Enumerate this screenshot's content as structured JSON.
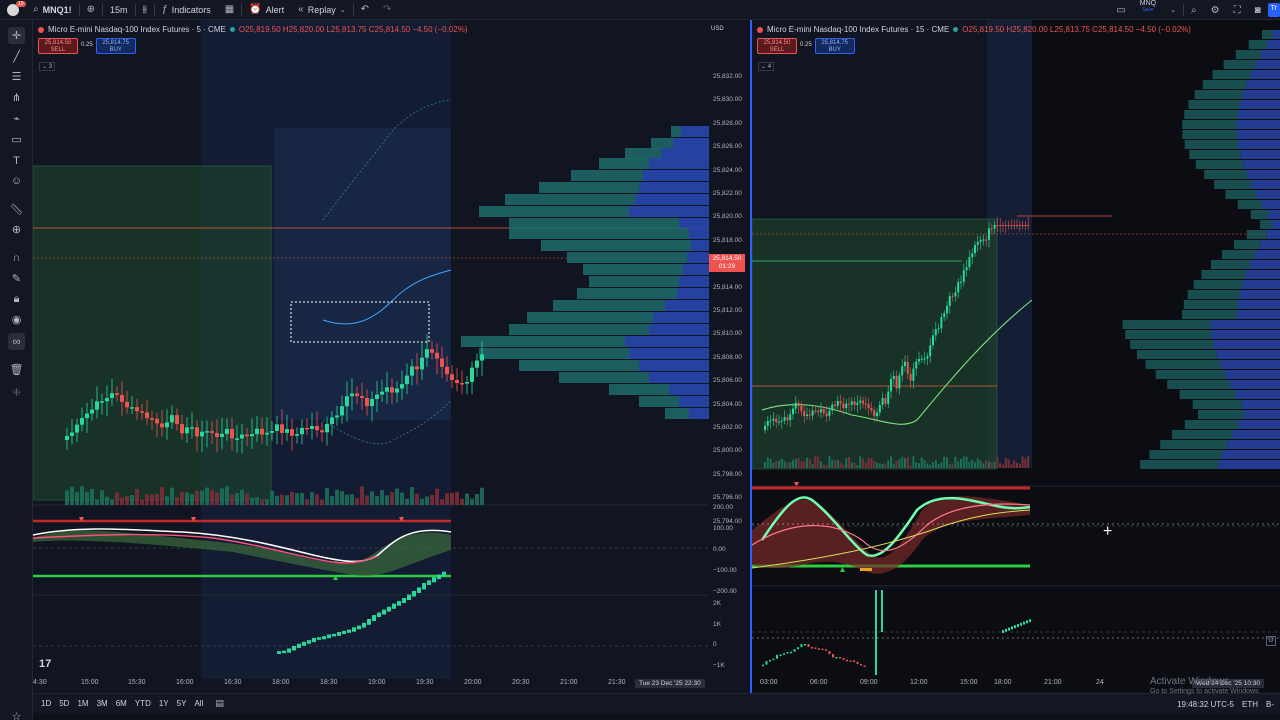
{
  "toolbar": {
    "notification_count": "10",
    "symbol": "MNQ1!",
    "interval": "15m",
    "indicators_label": "Indicators",
    "alert_label": "Alert",
    "replay_label": "Replay",
    "right_symbol": "MNQ",
    "right_symbol_sub": "Save",
    "right_cut": "Tr"
  },
  "left_chart": {
    "title": "Micro E-mini Nasdaq-100 Index Futures · 5 · CME",
    "ohlc": "O25,819.50 H25,820.00 L25,813.75 C25,814.50 −4.50 (−0.02%)",
    "sell_price": "25,814.50",
    "sell_label": "SELL",
    "qty": "0.25",
    "buy_price": "25,814.75",
    "buy_label": "BUY",
    "collapse_label": "3",
    "currency": "USD",
    "price_ticks": [
      "25,832.00",
      "25,830.00",
      "25,828.00",
      "25,826.00",
      "25,824.00",
      "25,822.00",
      "25,820.00",
      "25,818.00",
      "25,816.00",
      "25,814.00",
      "25,812.00",
      "25,810.00",
      "25,808.00",
      "25,806.00",
      "25,804.00",
      "25,802.00",
      "25,800.00",
      "25,798.00",
      "25,796.00",
      "25,794.00"
    ],
    "current_price": "25,814.50",
    "countdown": "01:29",
    "osc_ticks": [
      "200.00",
      "100.00",
      "0.00",
      "−100.00",
      "−200.00"
    ],
    "vol_ticks": [
      "2K",
      "1K",
      "0",
      "−1K"
    ],
    "time_ticks": [
      "4:30",
      "15:00",
      "15:30",
      "16:00",
      "16:30",
      "18:00",
      "18:30",
      "19:00",
      "19:30",
      "20:00",
      "20:30",
      "21:00",
      "21:30"
    ],
    "date_badge": "Tue 23 Dec '25   22:30"
  },
  "right_chart": {
    "title": "Micro E-mini Nasdaq-100 Index Futures · 15 · CME",
    "ohlc": "O25,819.50 H25,820.00 L25,813.75 C25,814.50 −4.50 (−0.02%)",
    "sell_price": "25,814.50",
    "sell_label": "SELL",
    "qty": "0.25",
    "buy_price": "25,814.75",
    "buy_label": "BUY",
    "collapse_label": "4",
    "time_ticks": [
      "03:00",
      "06:00",
      "09:00",
      "12:00",
      "15:00",
      "18:00",
      "21:00",
      "24"
    ],
    "date_badge": "Wed 24 Dec '25  10:30"
  },
  "bottom_bar": {
    "ranges": [
      "1D",
      "5D",
      "1M",
      "3M",
      "6M",
      "YTD",
      "1Y",
      "5Y",
      "All"
    ],
    "clock": "19:48:32 UTC-5",
    "session": "ETH",
    "cut": "B-"
  },
  "watermark": {
    "line1": "Activate Windows",
    "line2": "Go to Settings to activate Windows."
  },
  "colors": {
    "bull": "#26d99a",
    "bear": "#ef5350",
    "accent": "#2962ff",
    "profile_teal": "#1e6b6b",
    "profile_blue": "#2844a8"
  }
}
